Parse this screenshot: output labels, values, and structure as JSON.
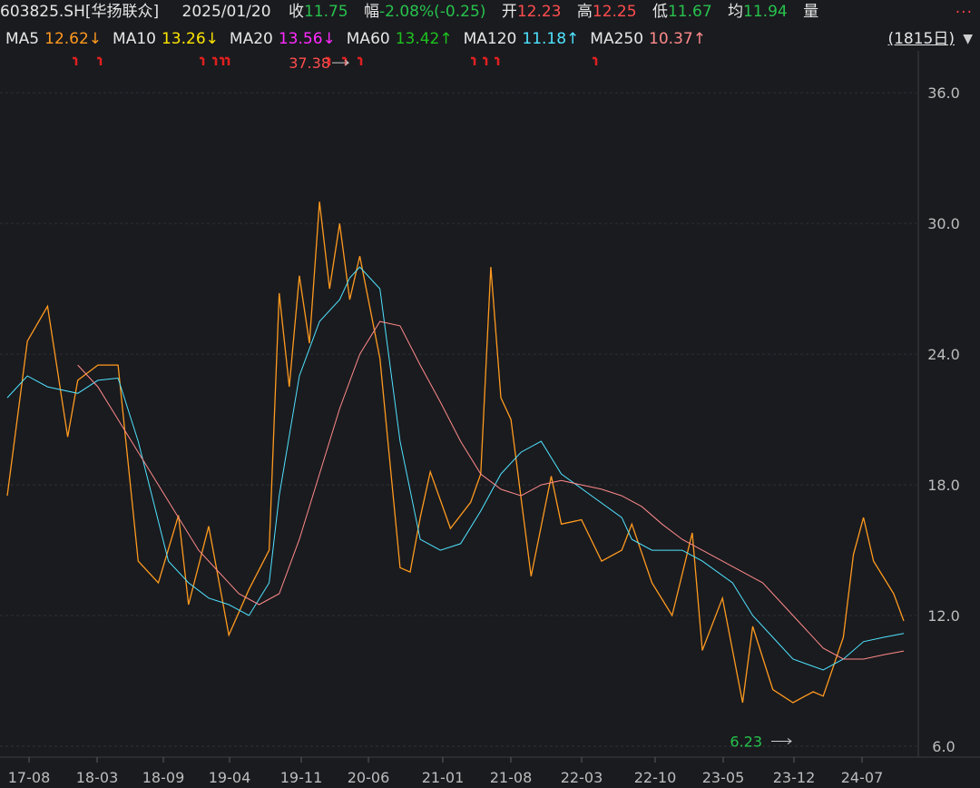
{
  "header": {
    "symbol": "603825.SH[华扬联众]",
    "date": "2025/01/20",
    "close_label": "收",
    "close": "11.75",
    "change_label": "幅",
    "change": "-2.08%(-0.25)",
    "open_label": "开",
    "open": "12.23",
    "high_label": "高",
    "high": "12.25",
    "low_label": "低",
    "low": "11.67",
    "avg_label": "均",
    "avg": "11.94",
    "vol_label": "量",
    "more": "..."
  },
  "ma_bar": {
    "items": [
      {
        "label": "MA5",
        "value": "12.62↓",
        "color": "#ff9a1f"
      },
      {
        "label": "MA10",
        "value": "13.26↓",
        "color": "#ffe500"
      },
      {
        "label": "MA20",
        "value": "13.56↓",
        "color": "#ff2bff"
      },
      {
        "label": "MA60",
        "value": "13.42↑",
        "color": "#1ec21e"
      },
      {
        "label": "MA120",
        "value": "11.18↑",
        "color": "#4fe3ff"
      },
      {
        "label": "MA250",
        "value": "10.37↑",
        "color": "#ff8a8a"
      }
    ],
    "period": "(1815日)"
  },
  "chart_data": {
    "type": "line",
    "title": "",
    "x_labels": [
      "17-08",
      "18-03",
      "18-09",
      "19-04",
      "19-11",
      "20-06",
      "21-01",
      "21-08",
      "22-03",
      "22-10",
      "23-05",
      "23-12",
      "24-07"
    ],
    "y_ticks": [
      "36.0",
      "30.0",
      "24.0",
      "18.0",
      "12.0",
      "6.0"
    ],
    "ylim": [
      6.0,
      37.8
    ],
    "annotations": {
      "max": "37.38",
      "min": "6.23"
    },
    "series": [
      {
        "color": "#ff9a1f",
        "x": [
          "2017-08",
          "2017-10",
          "2017-12",
          "2018-02",
          "2018-03",
          "2018-05",
          "2018-07",
          "2018-09",
          "2018-11",
          "2019-01",
          "2019-02",
          "2019-04",
          "2019-06",
          "2019-08",
          "2019-10",
          "2019-11",
          "2019-12",
          "2020-01",
          "2020-02",
          "2020-03",
          "2020-04",
          "2020-05",
          "2020-06",
          "2020-07",
          "2020-09",
          "2020-11",
          "2020-12",
          "2021-01",
          "2021-02",
          "2021-04",
          "2021-06",
          "2021-07",
          "2021-08",
          "2021-09",
          "2021-10",
          "2021-12",
          "2022-02",
          "2022-03",
          "2022-05",
          "2022-07",
          "2022-09",
          "2022-10",
          "2022-12",
          "2023-02",
          "2023-04",
          "2023-05",
          "2023-07",
          "2023-09",
          "2023-10",
          "2023-12",
          "2024-02",
          "2024-04",
          "2024-05",
          "2024-07",
          "2024-08",
          "2024-09",
          "2024-10",
          "2024-12",
          "2025-01"
        ],
        "values": [
          17.5,
          24.6,
          26.2,
          20.2,
          22.8,
          23.5,
          23.5,
          14.5,
          13.5,
          16.6,
          12.5,
          16.1,
          11.1,
          13.2,
          15.0,
          26.8,
          22.5,
          27.6,
          24.5,
          31.0,
          27.0,
          30.0,
          26.5,
          28.5,
          23.8,
          14.2,
          14.0,
          16.5,
          18.6,
          16.0,
          17.2,
          18.5,
          28.0,
          22.0,
          21.0,
          13.8,
          18.4,
          16.2,
          16.4,
          14.5,
          15.0,
          16.2,
          13.5,
          12.0,
          15.8,
          10.4,
          12.8,
          8.0,
          11.5,
          8.6,
          8.0,
          8.5,
          8.3,
          11.0,
          14.8,
          16.5,
          14.5,
          13.0,
          11.75
        ]
      },
      {
        "color": "#4fe3ff",
        "x": [
          "2017-08",
          "2017-10",
          "2017-12",
          "2018-03",
          "2018-05",
          "2018-07",
          "2018-09",
          "2018-12",
          "2019-02",
          "2019-04",
          "2019-06",
          "2019-08",
          "2019-10",
          "2019-11",
          "2020-01",
          "2020-03",
          "2020-05",
          "2020-06",
          "2020-07",
          "2020-09",
          "2020-11",
          "2021-01",
          "2021-03",
          "2021-05",
          "2021-07",
          "2021-09",
          "2021-11",
          "2022-01",
          "2022-03",
          "2022-06",
          "2022-09",
          "2022-10",
          "2022-12",
          "2023-03",
          "2023-05",
          "2023-08",
          "2023-10",
          "2023-12",
          "2024-02",
          "2024-05",
          "2024-07",
          "2024-09",
          "2024-11",
          "2025-01"
        ],
        "values": [
          22.0,
          23.0,
          22.5,
          22.2,
          22.8,
          22.9,
          20.0,
          14.5,
          13.5,
          12.8,
          12.5,
          12.0,
          13.5,
          17.5,
          23.0,
          25.5,
          26.5,
          27.5,
          28.0,
          27.0,
          20.0,
          15.5,
          15.0,
          15.3,
          16.8,
          18.5,
          19.5,
          20.0,
          18.5,
          17.5,
          16.5,
          15.5,
          15.0,
          15.0,
          14.5,
          13.5,
          12.0,
          11.0,
          10.0,
          9.5,
          10.0,
          10.8,
          11.0,
          11.18
        ]
      },
      {
        "color": "#ff8a8a",
        "x": [
          "2018-03",
          "2018-05",
          "2018-07",
          "2018-09",
          "2018-11",
          "2019-01",
          "2019-03",
          "2019-05",
          "2019-07",
          "2019-09",
          "2019-11",
          "2020-01",
          "2020-03",
          "2020-05",
          "2020-07",
          "2020-09",
          "2020-11",
          "2021-01",
          "2021-03",
          "2021-05",
          "2021-07",
          "2021-09",
          "2021-11",
          "2022-01",
          "2022-03",
          "2022-05",
          "2022-07",
          "2022-09",
          "2022-11",
          "2023-01",
          "2023-03",
          "2023-05",
          "2023-07",
          "2023-09",
          "2023-11",
          "2024-01",
          "2024-03",
          "2024-05",
          "2024-07",
          "2024-09",
          "2024-11",
          "2025-01"
        ],
        "values": [
          23.5,
          22.5,
          21.0,
          19.5,
          18.0,
          16.5,
          15.0,
          14.0,
          13.0,
          12.5,
          13.0,
          15.5,
          18.5,
          21.5,
          24.0,
          25.5,
          25.3,
          23.5,
          21.8,
          20.0,
          18.5,
          17.8,
          17.5,
          18.0,
          18.2,
          18.0,
          17.8,
          17.5,
          17.0,
          16.2,
          15.5,
          15.0,
          14.5,
          14.0,
          13.5,
          12.5,
          11.5,
          10.5,
          10.0,
          10.0,
          10.2,
          10.37
        ]
      }
    ]
  }
}
